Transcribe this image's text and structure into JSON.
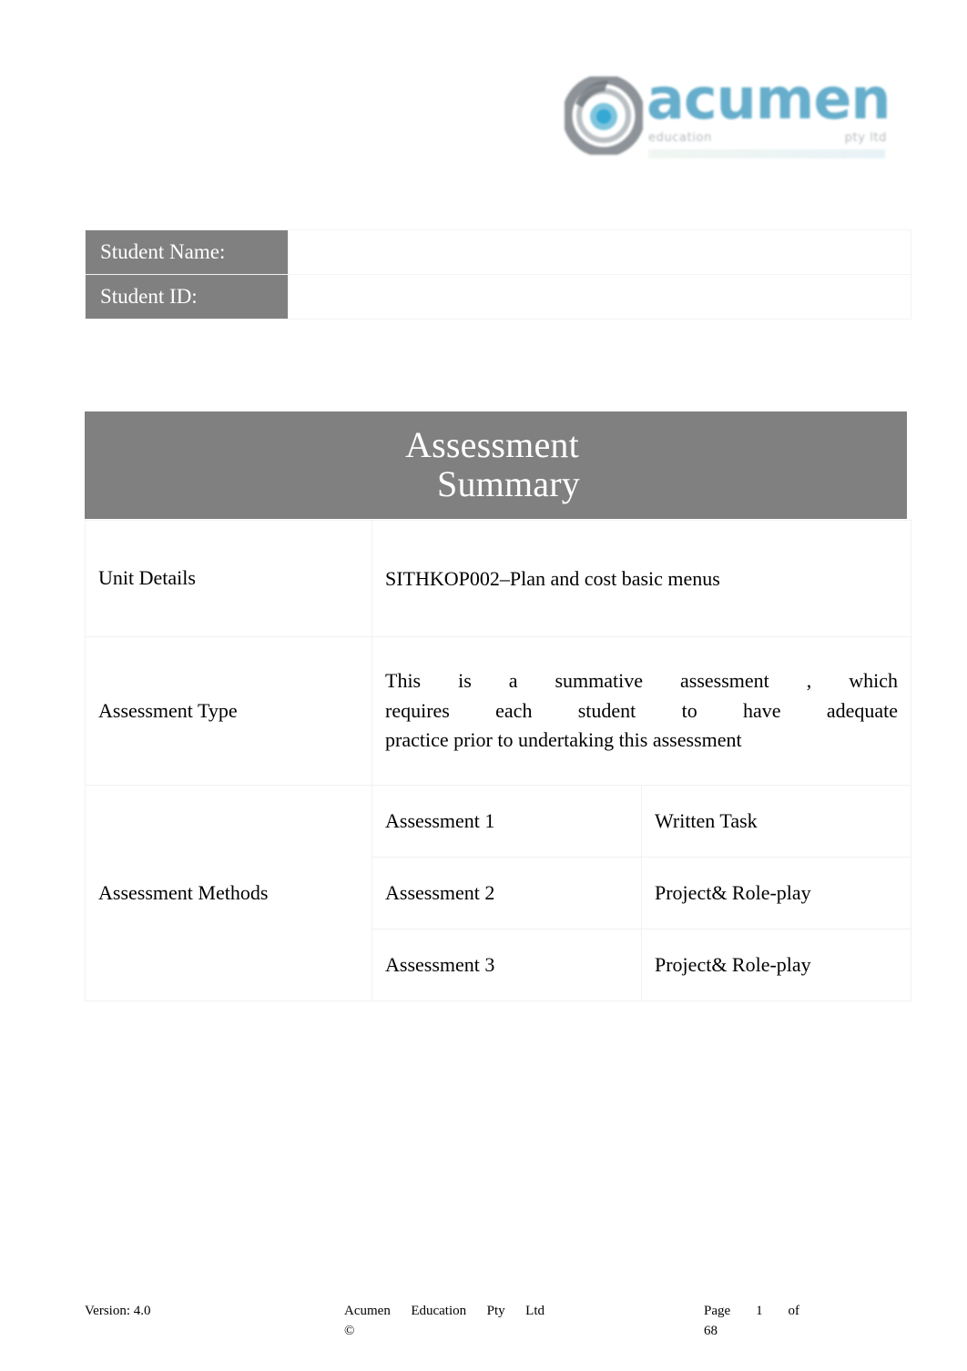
{
  "logo": {
    "mark_icon": "acumen-circle-logomark",
    "wordmark": "acumen",
    "tagline_left": "education",
    "tagline_right": "pty ltd",
    "brand_blue": "#5aa8c8",
    "brand_gray": "#9aa3a8"
  },
  "student_info": {
    "name_label": "Student Name:",
    "name_value": "",
    "id_label": "Student ID:",
    "id_value": "",
    "label_bg": "#808080",
    "label_color": "#ffffff"
  },
  "summary_header": {
    "line1": "Assessment",
    "line2": "Summary",
    "bg": "#808080",
    "color": "#ffffff"
  },
  "summary_table": {
    "unit": {
      "label": "Unit Details",
      "value": "SITHKOP002–Plan and cost basic menus"
    },
    "assessment_type": {
      "label": "Assessment Type",
      "line1": "This is a  summative assessment       , which",
      "line2": "requires each student to have adequate",
      "line3": "practice prior to undertaking this assessment",
      "full_text": "This is a  summative assessment , which requires each student to have adequate practice prior to undertaking this assessment"
    },
    "assessment_methods": {
      "label": "Assessment Methods",
      "rows": [
        {
          "name": "Assessment 1",
          "method": "Written Task"
        },
        {
          "name": "Assessment 2",
          "method": "Project& Role-play"
        },
        {
          "name": "Assessment 3",
          "method": "Project& Role-play"
        }
      ]
    }
  },
  "footer": {
    "version": "Version: 4.0",
    "company_line": "Acumen Education Pty Ltd",
    "copyright_symbol": "©",
    "page_line1": "Page 1    of",
    "page_line2": "68"
  }
}
